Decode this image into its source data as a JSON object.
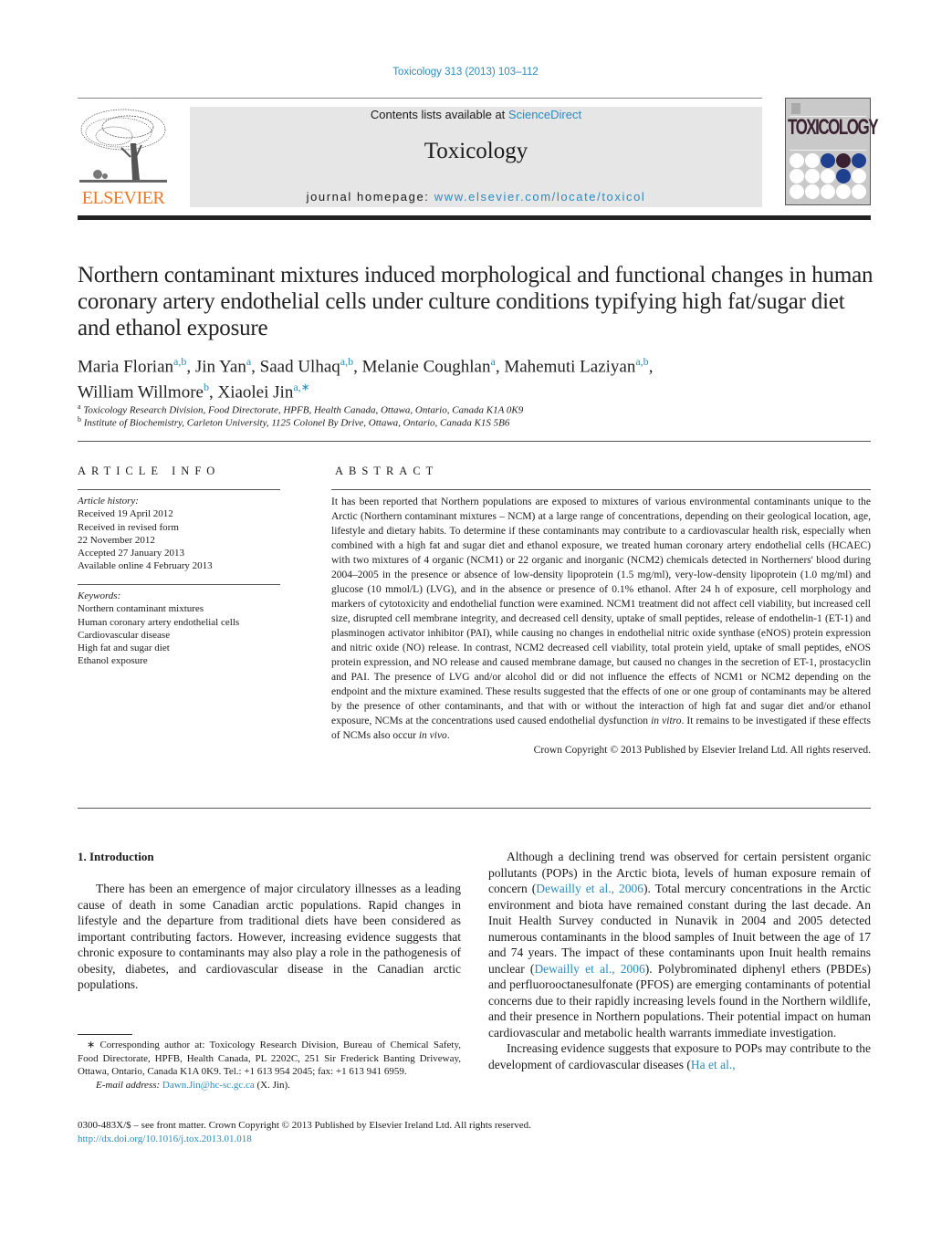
{
  "header": {
    "citation": "Toxicology 313 (2013) 103–112",
    "contents_prefix": "Contents lists available at ",
    "contents_link": "ScienceDirect",
    "journal_title": "Toxicology",
    "homepage_prefix": "journal homepage: ",
    "homepage_link": "www.elsevier.com/locate/toxicol",
    "publisher_logo_text": "ELSEVIER",
    "cover_title": "TOXICOLOGY",
    "cover_dot_colors": [
      "#ffffff",
      "#ffffff",
      "#1f3f8f",
      "#3a2232",
      "#1f3f8f",
      "#ffffff",
      "#ffffff",
      "#ffffff",
      "#1f3f8f",
      "#ffffff",
      "#ffffff",
      "#ffffff",
      "#ffffff",
      "#ffffff",
      "#ffffff"
    ]
  },
  "article": {
    "title": "Northern contaminant mixtures induced morphological and functional changes in human coronary artery endothelial cells under culture conditions typifying high fat/sugar diet and ethanol exposure",
    "authors": [
      {
        "name": "Maria Florian",
        "aff": "a,b"
      },
      {
        "name": "Jin Yan",
        "aff": "a"
      },
      {
        "name": "Saad Ulhaq",
        "aff": "a,b"
      },
      {
        "name": "Melanie Coughlan",
        "aff": "a"
      },
      {
        "name": "Mahemuti Laziyan",
        "aff": "a,b"
      },
      {
        "name": "William Willmore",
        "aff": "b"
      },
      {
        "name": "Xiaolei Jin",
        "aff": "a,∗"
      }
    ],
    "affiliations": [
      {
        "key": "a",
        "text": "Toxicology Research Division, Food Directorate, HPFB, Health Canada, Ottawa, Ontario, Canada K1A 0K9"
      },
      {
        "key": "b",
        "text": "Institute of Biochemistry, Carleton University, 1125 Colonel By Drive, Ottawa, Ontario, Canada K1S 5B6"
      }
    ]
  },
  "article_info": {
    "heading": "ARTICLE INFO",
    "history_label": "Article history:",
    "history": [
      "Received 19 April 2012",
      "Received in revised form",
      "22 November 2012",
      "Accepted 27 January 2013",
      "Available online 4 February 2013"
    ],
    "keywords_label": "Keywords:",
    "keywords": [
      "Northern contaminant mixtures",
      "Human coronary artery endothelial cells",
      "Cardiovascular disease",
      "High fat and sugar diet",
      "Ethanol exposure"
    ]
  },
  "abstract": {
    "heading": "ABSTRACT",
    "text_main": "It has been reported that Northern populations are exposed to mixtures of various environmental contaminants unique to the Arctic (Northern contaminant mixtures – NCM) at a large range of concentrations, depending on their geological location, age, lifestyle and dietary habits. To determine if these contaminants may contribute to a cardiovascular health risk, especially when combined with a high fat and sugar diet and ethanol exposure, we treated human coronary artery endothelial cells (HCAEC) with two mixtures of 4 organic (NCM1) or 22 organic and inorganic (NCM2) chemicals detected in Northerners' blood during 2004–2005 in the presence or absence of low-density lipoprotein (1.5 mg/ml), very-low-density lipoprotein (1.0 mg/ml) and glucose (10 mmol/L) (LVG), and in the absence or presence of 0.1% ethanol. After 24 h of exposure, cell morphology and markers of cytotoxicity and endothelial function were examined. NCM1 treatment did not affect cell viability, but increased cell size, disrupted cell membrane integrity, and decreased cell density, uptake of small peptides, release of endothelin-1 (ET-1) and plasminogen activator inhibitor (PAI), while causing no changes in endothelial nitric oxide synthase (eNOS) protein expression and nitric oxide (NO) release. In contrast, NCM2 decreased cell viability, total protein yield, uptake of small peptides, eNOS protein expression, and NO release and caused membrane damage, but caused no changes in the secretion of ET-1, prostacyclin and PAI. The presence of LVG and/or alcohol did or did not influence the effects of NCM1 or NCM2 depending on the endpoint and the mixture examined. These results suggested that the effects of one or one group of contaminants may be altered by the presence of other contaminants, and that with or without the interaction of high fat and sugar diet and/or ethanol exposure, NCMs at the concentrations used caused endothelial dysfunction ",
    "italic_1": "in vitro",
    "text_2": ". It remains to be investigated if these effects of NCMs also occur ",
    "italic_2": "in vivo",
    "text_3": ".",
    "copyright": "Crown Copyright © 2013 Published by Elsevier Ireland Ltd. All rights reserved."
  },
  "introduction": {
    "heading": "1.  Introduction",
    "para1": "There has been an emergence of major circulatory illnesses as a leading cause of death in some Canadian arctic populations. Rapid changes in lifestyle and the departure from traditional diets have been considered as important contributing factors. However, increasing evidence suggests that chronic exposure to contaminants may also play a role in the pathogenesis of obesity, diabetes, and cardiovascular disease in the Canadian arctic populations.",
    "para2_a": "Although a declining trend was observed for certain persistent organic pollutants (POPs) in the Arctic biota, levels of human exposure remain of concern (",
    "ref1": "Dewailly et al., 2006",
    "para2_b": "). Total mercury concentrations in the Arctic environment and biota have remained constant during the last decade. An Inuit Health Survey conducted in Nunavik in 2004 and 2005 detected numerous contaminants in the blood samples of Inuit between the age of 17 and 74 years. The impact of these contaminants upon Inuit health remains unclear (",
    "ref2": "Dewailly et al., 2006",
    "para2_c": "). Polybrominated diphenyl ethers (PBDEs) and perfluorooctanesulfonate (PFOS) are emerging contaminants of potential concerns due to their rapidly increasing levels found in the Northern wildlife, and their presence in Northern populations. Their potential impact on human cardiovascular and metabolic health warrants immediate investigation.",
    "para3_a": "Increasing evidence suggests that exposure to POPs may contribute to the development of cardiovascular diseases (",
    "ref3": "Ha et al.,"
  },
  "footnote": {
    "corresponding": "∗ Corresponding author at: Toxicology Research Division, Bureau of Chemical Safety, Food Directorate, HPFB, Health Canada, PL 2202C, 251 Sir Frederick Banting Driveway, Ottawa, Ontario, Canada K1A 0K9. Tel.: +1 613 954 2045; fax: +1 613 941 6959.",
    "email_label": "E-mail address:",
    "email": "Dawn.Jin@hc-sc.gc.ca",
    "email_suffix": " (X. Jin)."
  },
  "footer": {
    "front_matter": "0300-483X/$ – see front matter. Crown Copyright © 2013 Published by Elsevier Ireland Ltd. All rights reserved.",
    "doi": "http://dx.doi.org/10.1016/j.tox.2013.01.018"
  }
}
